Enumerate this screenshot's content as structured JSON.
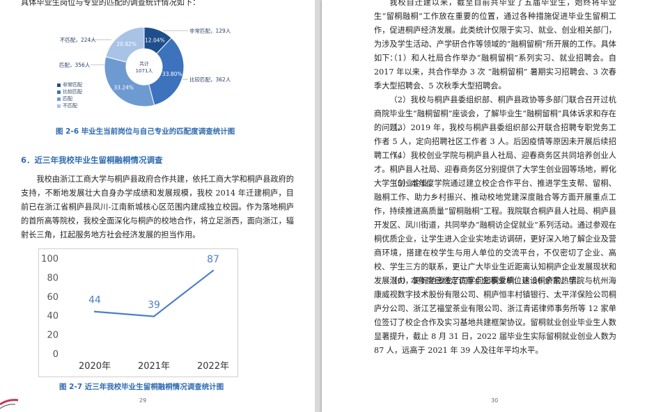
{
  "left_page": {
    "intro_text": "具体毕业生岗位与专业的匹配的调查统计情况如下：",
    "figure_2_6": {
      "caption": "图 2-6  毕业生当前岗位与自己专业的匹配度调查统计图",
      "center_label_line1": "共计",
      "center_label_line2": "1071人",
      "labels": {
        "very_match": "非常匹配，129人",
        "relatively_match": "比较匹配，362人",
        "match": "匹配，356人",
        "not_match": "不匹配，224人"
      },
      "percent_labels": {
        "very_match": "12.04%",
        "relatively_match": "33.80%",
        "match": "33.24%",
        "not_match": "20.92%"
      },
      "legend": [
        "非常匹配",
        "比较匹配",
        "匹配",
        "不匹配"
      ],
      "colors": [
        "#1f4e8c",
        "#3d72bd",
        "#6e9ad2",
        "#a9c3e6"
      ]
    },
    "section_title": "6．近三年我校毕业生留桐融桐情况调查",
    "section_paragraph": "我校由浙江工商大学与桐庐县政府合作共建，依托工商大学和桐庐县政府的支持，不断地发展壮大自身办学成绩和发展规模，我校 2014 年迁建桐庐，目前已在浙江省桐庐县凤川-江南新城核心区范围内建成独立校园。作为落地桐庐的首所高等院校，我校全面深化与桐庐的校地合作，将立足浙西，面向浙江，辐射长三角，扛起服务地方社会经济发展的担当作用。",
    "figure_2_7": {
      "caption": "图 2-7  近三年我校毕业生留桐融桐情况调查统计图"
    },
    "page_number": "29"
  },
  "right_page": {
    "paragraphs": [
      "我校自迁建以来，截至目前共毕业了五届毕业生，始终将毕业生“留桐融桐”工作放在重要的位置，通过各种措施促进毕业生留桐工作，促进桐庐经济发展。此类统计仅限于实习、就业、创业相关部门，为涉及学生活动、产学研合作等领域的“融桐留桐”所开展的工作。具体如下：",
      "（1）和人社局合作举办“融桐留桐”系列实习、就业招聘会。自 2017 年以来，共合作举办 3 次 “融桐留桐” 暑期实习招聘会、3 次春季大型招聘会、5 次秋季大型招聘会。",
      "（2）我校与桐庐县委组织部、桐庐县政协等多部门联合召开过杭商院毕业生“融桐留桐”座谈会，了解毕业生“融桐留桐”具体诉求和存在的问题。",
      "（3）2019 年，我校与桐庐县委组织部公开联合招聘专职党务工作者 5 人，定向招聘社区工作者 3 人。后因疫情等原因未开展后续招聘工作。",
      "（4）我校创业学院与桐庐县人社局、迎春商务区共同培养创业人才。桐庐县人社局、迎春商务区分别提供了大学生创业园等场地，孵化大学生创业企业。",
      "（5）本年度学院通过建立校企合作平台、推进学生支帮、留桐、融桐工作、助力乡村振兴、推动校地党建深度融合等方面开展重点工作，持续推进高质量“留桐融桐”工程。我院联合桐庐县人社局、桐庐县开发区、凤川街道，共同举办“融桐访企促就业”系列活动。通过参观在桐优质企业，让学生进入企业实地走访调研，更好深入地了解企业及营商环境，搭建在校学生与用人单位的交流平台，不仅密切了企业、高校、学生三方的联系，更让广大毕业生近距离认知桐庐企业发展现状和发展潜力，更好地激发了同学们知桐爱桐、建设桐庐的热情。",
      "（6）本年度已经走访重点企事业单位达 50 余家。学院与杭州海康威视数字技术股份有限公司、桐庐恒丰村镇银行、太平洋保险公司桐庐分公司、浙江艺福堂茶业有限公司、浙江青诺律师事务所等 12 家单位签订了校企合作及实习基地共建框架协议。留桐就业创业毕业生人数显著提升，截止 8 月 31 日，2022 届毕业生实际留桐就业创业人数为 87 人，远高于 2021 年 39 人及往年平均水平。"
    ],
    "page_number": "30"
  },
  "chart_data": [
    {
      "type": "pie",
      "title": "",
      "center_text": "共计 1071人",
      "categories": [
        "非常匹配",
        "比较匹配",
        "匹配",
        "不匹配"
      ],
      "values": [
        129,
        362,
        356,
        224
      ],
      "percentages": [
        12.04,
        33.8,
        33.24,
        20.92
      ],
      "legend": "left"
    },
    {
      "type": "line",
      "title": "",
      "categories": [
        "2020年",
        "2021年",
        "2022年"
      ],
      "series": [
        {
          "values": [
            44,
            39,
            87
          ]
        }
      ],
      "ylim": [
        0,
        100
      ],
      "yticks": [
        "0",
        "20",
        "40",
        "60",
        "80",
        "100"
      ],
      "data_labels": [
        "44",
        "39",
        "87"
      ],
      "grid": false,
      "color": "#4a7ec7"
    }
  ]
}
